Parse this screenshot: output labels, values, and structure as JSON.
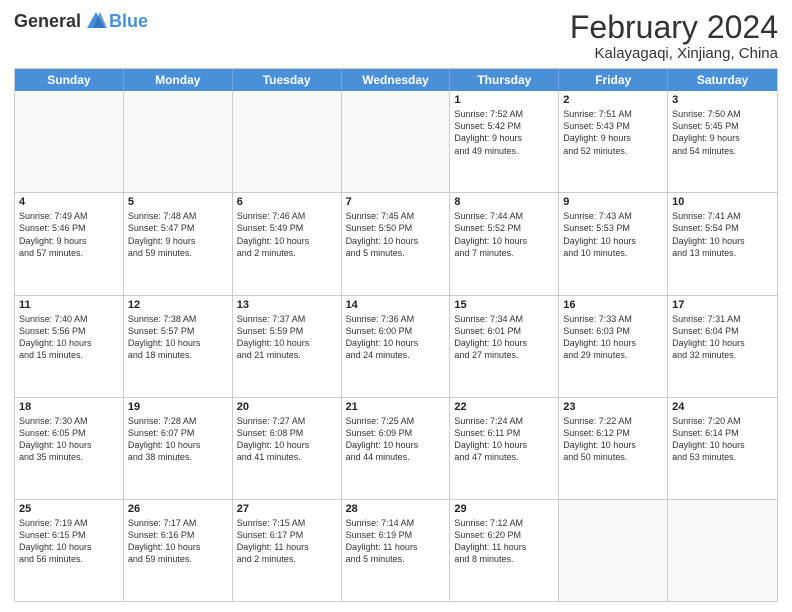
{
  "header": {
    "logo_general": "General",
    "logo_blue": "Blue",
    "title": "February 2024",
    "subtitle": "Kalayagaqi, Xinjiang, China"
  },
  "days": [
    "Sunday",
    "Monday",
    "Tuesday",
    "Wednesday",
    "Thursday",
    "Friday",
    "Saturday"
  ],
  "rows": [
    [
      {
        "day": "",
        "text": ""
      },
      {
        "day": "",
        "text": ""
      },
      {
        "day": "",
        "text": ""
      },
      {
        "day": "",
        "text": ""
      },
      {
        "day": "1",
        "text": "Sunrise: 7:52 AM\nSunset: 5:42 PM\nDaylight: 9 hours\nand 49 minutes."
      },
      {
        "day": "2",
        "text": "Sunrise: 7:51 AM\nSunset: 5:43 PM\nDaylight: 9 hours\nand 52 minutes."
      },
      {
        "day": "3",
        "text": "Sunrise: 7:50 AM\nSunset: 5:45 PM\nDaylight: 9 hours\nand 54 minutes."
      }
    ],
    [
      {
        "day": "4",
        "text": "Sunrise: 7:49 AM\nSunset: 5:46 PM\nDaylight: 9 hours\nand 57 minutes."
      },
      {
        "day": "5",
        "text": "Sunrise: 7:48 AM\nSunset: 5:47 PM\nDaylight: 9 hours\nand 59 minutes."
      },
      {
        "day": "6",
        "text": "Sunrise: 7:46 AM\nSunset: 5:49 PM\nDaylight: 10 hours\nand 2 minutes."
      },
      {
        "day": "7",
        "text": "Sunrise: 7:45 AM\nSunset: 5:50 PM\nDaylight: 10 hours\nand 5 minutes."
      },
      {
        "day": "8",
        "text": "Sunrise: 7:44 AM\nSunset: 5:52 PM\nDaylight: 10 hours\nand 7 minutes."
      },
      {
        "day": "9",
        "text": "Sunrise: 7:43 AM\nSunset: 5:53 PM\nDaylight: 10 hours\nand 10 minutes."
      },
      {
        "day": "10",
        "text": "Sunrise: 7:41 AM\nSunset: 5:54 PM\nDaylight: 10 hours\nand 13 minutes."
      }
    ],
    [
      {
        "day": "11",
        "text": "Sunrise: 7:40 AM\nSunset: 5:56 PM\nDaylight: 10 hours\nand 15 minutes."
      },
      {
        "day": "12",
        "text": "Sunrise: 7:38 AM\nSunset: 5:57 PM\nDaylight: 10 hours\nand 18 minutes."
      },
      {
        "day": "13",
        "text": "Sunrise: 7:37 AM\nSunset: 5:59 PM\nDaylight: 10 hours\nand 21 minutes."
      },
      {
        "day": "14",
        "text": "Sunrise: 7:36 AM\nSunset: 6:00 PM\nDaylight: 10 hours\nand 24 minutes."
      },
      {
        "day": "15",
        "text": "Sunrise: 7:34 AM\nSunset: 6:01 PM\nDaylight: 10 hours\nand 27 minutes."
      },
      {
        "day": "16",
        "text": "Sunrise: 7:33 AM\nSunset: 6:03 PM\nDaylight: 10 hours\nand 29 minutes."
      },
      {
        "day": "17",
        "text": "Sunrise: 7:31 AM\nSunset: 6:04 PM\nDaylight: 10 hours\nand 32 minutes."
      }
    ],
    [
      {
        "day": "18",
        "text": "Sunrise: 7:30 AM\nSunset: 6:05 PM\nDaylight: 10 hours\nand 35 minutes."
      },
      {
        "day": "19",
        "text": "Sunrise: 7:28 AM\nSunset: 6:07 PM\nDaylight: 10 hours\nand 38 minutes."
      },
      {
        "day": "20",
        "text": "Sunrise: 7:27 AM\nSunset: 6:08 PM\nDaylight: 10 hours\nand 41 minutes."
      },
      {
        "day": "21",
        "text": "Sunrise: 7:25 AM\nSunset: 6:09 PM\nDaylight: 10 hours\nand 44 minutes."
      },
      {
        "day": "22",
        "text": "Sunrise: 7:24 AM\nSunset: 6:11 PM\nDaylight: 10 hours\nand 47 minutes."
      },
      {
        "day": "23",
        "text": "Sunrise: 7:22 AM\nSunset: 6:12 PM\nDaylight: 10 hours\nand 50 minutes."
      },
      {
        "day": "24",
        "text": "Sunrise: 7:20 AM\nSunset: 6:14 PM\nDaylight: 10 hours\nand 53 minutes."
      }
    ],
    [
      {
        "day": "25",
        "text": "Sunrise: 7:19 AM\nSunset: 6:15 PM\nDaylight: 10 hours\nand 56 minutes."
      },
      {
        "day": "26",
        "text": "Sunrise: 7:17 AM\nSunset: 6:16 PM\nDaylight: 10 hours\nand 59 minutes."
      },
      {
        "day": "27",
        "text": "Sunrise: 7:15 AM\nSunset: 6:17 PM\nDaylight: 11 hours\nand 2 minutes."
      },
      {
        "day": "28",
        "text": "Sunrise: 7:14 AM\nSunset: 6:19 PM\nDaylight: 11 hours\nand 5 minutes."
      },
      {
        "day": "29",
        "text": "Sunrise: 7:12 AM\nSunset: 6:20 PM\nDaylight: 11 hours\nand 8 minutes."
      },
      {
        "day": "",
        "text": ""
      },
      {
        "day": "",
        "text": ""
      }
    ]
  ]
}
